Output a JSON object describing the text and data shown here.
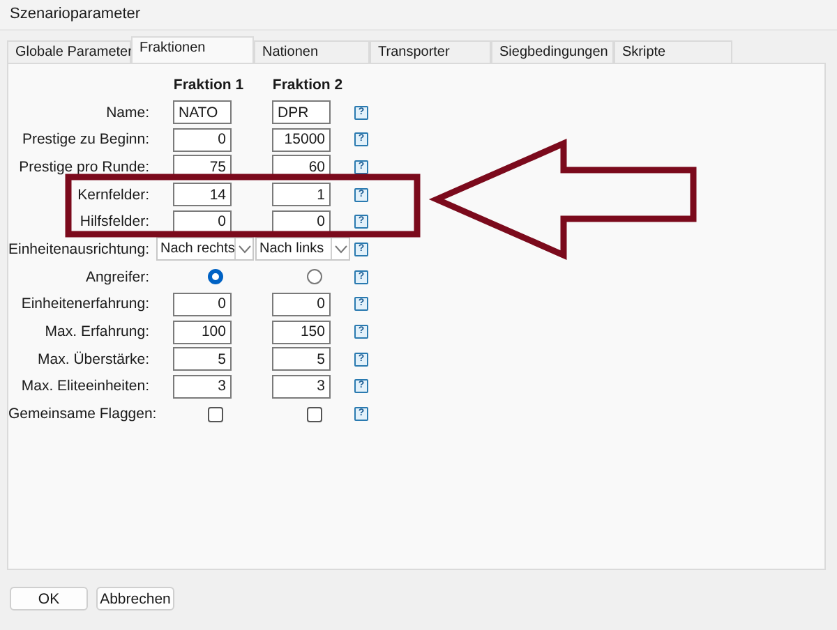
{
  "window": {
    "title": "Szenarioparameter"
  },
  "tabs": [
    {
      "label": "Globale Parameter",
      "selected": false
    },
    {
      "label": "Fraktionen",
      "selected": true
    },
    {
      "label": "Nationen",
      "selected": false
    },
    {
      "label": "Transporter",
      "selected": false
    },
    {
      "label": "Siegbedingungen",
      "selected": false
    },
    {
      "label": "Skripte",
      "selected": false
    }
  ],
  "columns": [
    "Fraktion 1",
    "Fraktion 2"
  ],
  "rows": [
    {
      "label": "Name:",
      "kind": "text",
      "values": [
        "NATO",
        "DPR"
      ]
    },
    {
      "label": "Prestige zu Beginn:",
      "kind": "number",
      "values": [
        "0",
        "15000"
      ]
    },
    {
      "label": "Prestige pro Runde:",
      "kind": "number",
      "values": [
        "75",
        "60"
      ]
    },
    {
      "label": "Kernfelder:",
      "kind": "number",
      "values": [
        "14",
        "1"
      ]
    },
    {
      "label": "Hilfsfelder:",
      "kind": "number",
      "values": [
        "0",
        "0"
      ]
    },
    {
      "label": "Einheitenausrichtung:",
      "kind": "dropdown",
      "values": [
        "Nach rechts",
        "Nach links"
      ]
    },
    {
      "label": "Angreifer:",
      "kind": "radio",
      "options": [
        {
          "selected": true
        },
        {
          "selected": false
        }
      ]
    },
    {
      "label": "Einheitenerfahrung:",
      "kind": "number",
      "values": [
        "0",
        "0"
      ]
    },
    {
      "label": "Max. Erfahrung:",
      "kind": "number",
      "values": [
        "100",
        "150"
      ]
    },
    {
      "label": "Max. Überstärke:",
      "kind": "number",
      "values": [
        "5",
        "5"
      ]
    },
    {
      "label": "Max. Eliteeinheiten:",
      "kind": "number",
      "values": [
        "3",
        "3"
      ]
    },
    {
      "label": "Gemeinsame Flaggen:",
      "kind": "checkbox",
      "options": [
        {
          "checked": false
        },
        {
          "checked": false
        }
      ]
    }
  ],
  "help_mark": "?",
  "buttons": [
    "OK",
    "Abbrechen"
  ]
}
